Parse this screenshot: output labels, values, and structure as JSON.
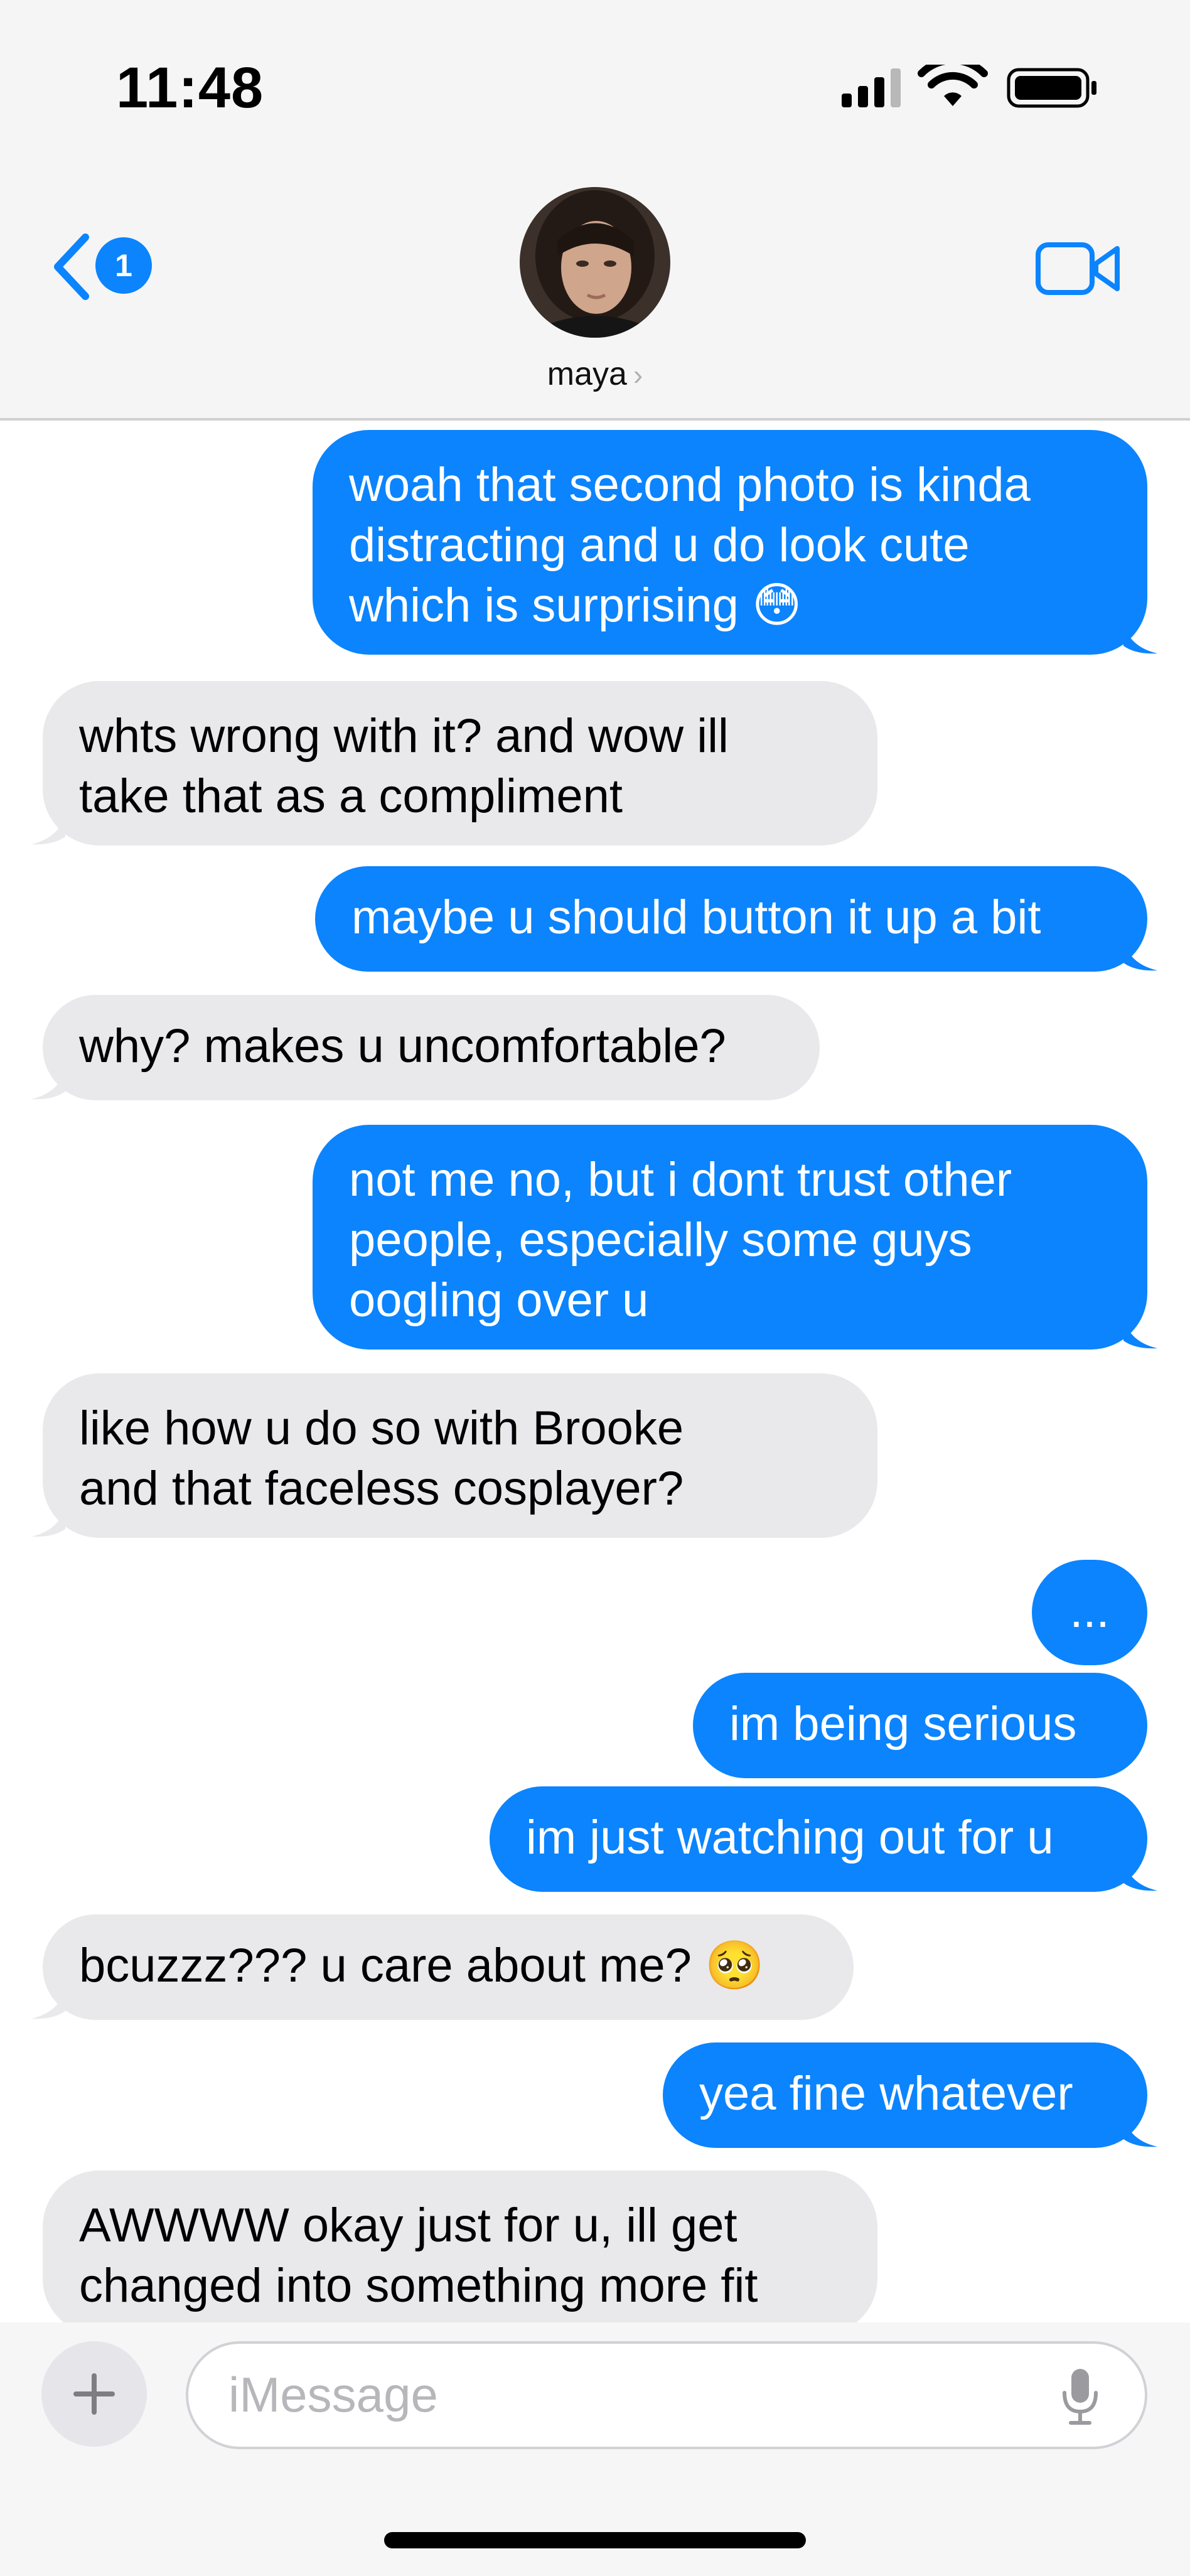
{
  "status_bar": {
    "time": "11:48"
  },
  "header": {
    "unread_count": "1",
    "contact_name": "maya",
    "name_chevron": "›"
  },
  "messages": [
    {
      "direction": "sent",
      "lines": [
        "woah that second photo is kinda",
        "distracting and u do look cute",
        "which is surprising 😳"
      ]
    },
    {
      "direction": "received",
      "lines": [
        "whts wrong with it? and wow ill",
        "take that as a compliment"
      ]
    },
    {
      "direction": "sent",
      "lines": [
        "maybe u should button it up a bit"
      ]
    },
    {
      "direction": "received",
      "lines": [
        "why? makes u uncomfortable?"
      ]
    },
    {
      "direction": "sent",
      "lines": [
        "not me no, but i dont trust other",
        "people, especially some guys",
        "oogling over u"
      ]
    },
    {
      "direction": "received",
      "lines": [
        "like how u do so with Brooke",
        "and that faceless cosplayer?"
      ]
    },
    {
      "direction": "sent",
      "lines": [
        "..."
      ]
    },
    {
      "direction": "sent",
      "lines": [
        "im being serious"
      ]
    },
    {
      "direction": "sent",
      "lines": [
        "im just watching out for u"
      ]
    },
    {
      "direction": "received",
      "lines": [
        "bcuzzz??? u care about me? 🥺"
      ]
    },
    {
      "direction": "sent",
      "lines": [
        "yea fine whatever"
      ]
    },
    {
      "direction": "received",
      "lines": [
        "AWWWW okay just for u, ill get",
        "changed into something more fit"
      ]
    }
  ],
  "composer": {
    "placeholder": "iMessage"
  },
  "colors": {
    "sent_bubble": "#0b84fe",
    "received_bubble": "#e9e9eb",
    "accent": "#0b84fe"
  },
  "icons": [
    "signal-icon",
    "wifi-icon",
    "battery-icon",
    "back-chevron-icon",
    "facetime-video-icon",
    "plus-icon",
    "microphone-icon"
  ]
}
